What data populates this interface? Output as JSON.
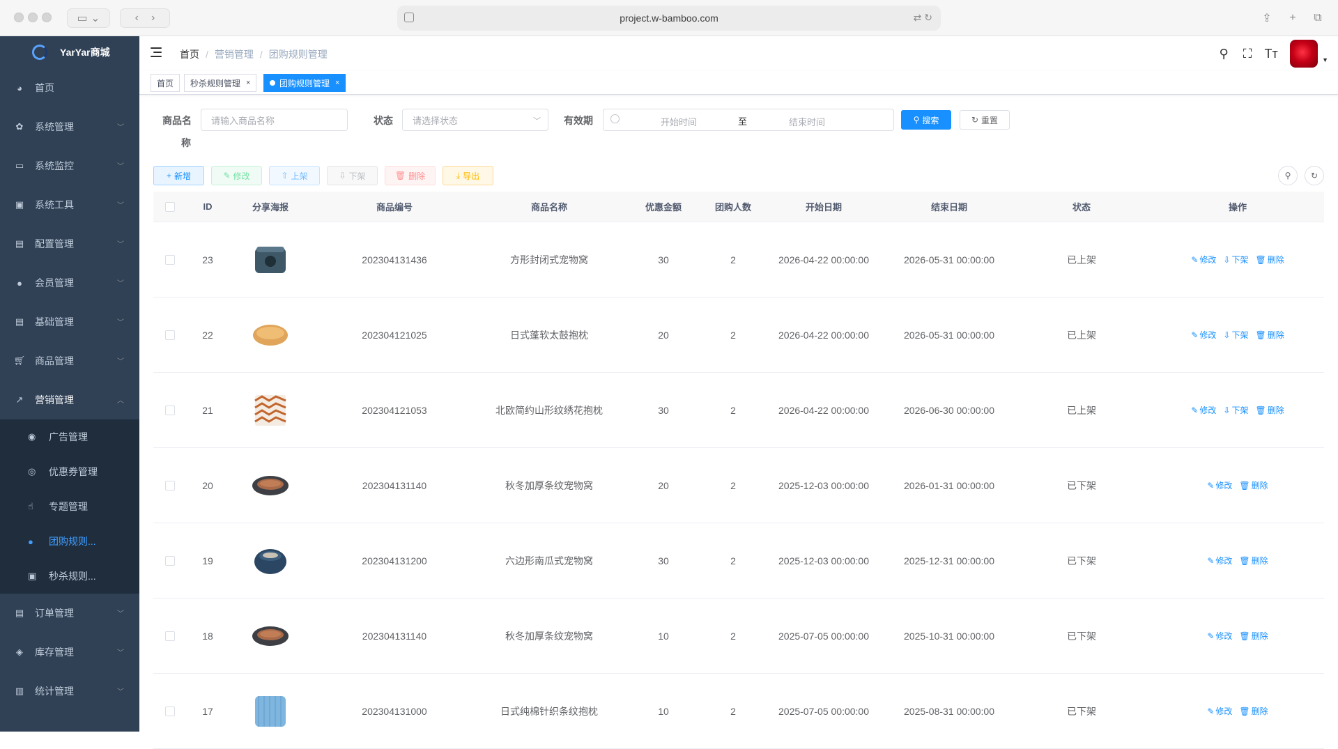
{
  "browser": {
    "url": "project.w-bamboo.com"
  },
  "app": {
    "logo_text": "YarYar商城"
  },
  "sidebar": {
    "items": [
      {
        "label": "首页",
        "icon": "dashboard-icon"
      },
      {
        "label": "系统管理",
        "icon": "gear-icon"
      },
      {
        "label": "系统监控",
        "icon": "monitor-icon"
      },
      {
        "label": "系统工具",
        "icon": "toolbox-icon"
      },
      {
        "label": "配置管理",
        "icon": "config-icon"
      },
      {
        "label": "会员管理",
        "icon": "user-icon"
      },
      {
        "label": "基础管理",
        "icon": "base-icon"
      },
      {
        "label": "商品管理",
        "icon": "cart-icon"
      },
      {
        "label": "营销管理",
        "icon": "marketing-icon"
      }
    ],
    "marketing_sub": [
      {
        "label": "广告管理",
        "icon": "eye-icon"
      },
      {
        "label": "优惠券管理",
        "icon": "coupon-icon"
      },
      {
        "label": "专题管理",
        "icon": "topic-icon"
      },
      {
        "label": "团购规则...",
        "icon": "group-icon"
      },
      {
        "label": "秒杀规则...",
        "icon": "flash-icon"
      }
    ],
    "bottom_items": [
      {
        "label": "订单管理",
        "icon": "order-icon"
      },
      {
        "label": "库存管理",
        "icon": "stock-icon"
      },
      {
        "label": "统计管理",
        "icon": "stats-icon"
      }
    ]
  },
  "breadcrumb": [
    "首页",
    "营销管理",
    "团购规则管理"
  ],
  "tags": [
    {
      "label": "首页"
    },
    {
      "label": "秒杀规则管理"
    },
    {
      "label": "团购规则管理"
    }
  ],
  "filter": {
    "name_label_1": "商品名",
    "name_label_2": "称",
    "name_placeholder": "请输入商品名称",
    "status_label": "状态",
    "status_placeholder": "请选择状态",
    "period_label": "有效期",
    "start_placeholder": "开始时间",
    "range_sep": "至",
    "end_placeholder": "结束时间",
    "search_btn": "搜索",
    "reset_btn": "重置"
  },
  "toolbar": {
    "add": "新增",
    "edit": "修改",
    "on_shelf": "上架",
    "off_shelf": "下架",
    "delete": "删除",
    "export": "导出"
  },
  "table": {
    "headers": [
      "ID",
      "分享海报",
      "商品编号",
      "商品名称",
      "优惠金额",
      "团购人数",
      "开始日期",
      "结束日期",
      "状态",
      "操作"
    ],
    "op_labels": {
      "edit": "修改",
      "off": "下架",
      "delete": "删除"
    },
    "rows": [
      {
        "id": "23",
        "code": "202304131436",
        "name": "方形封闭式宠物窝",
        "discount": "30",
        "people": "2",
        "start": "2026-04-22 00:00:00",
        "end": "2026-05-31 00:00:00",
        "status": "已上架",
        "thumb": "pet-house"
      },
      {
        "id": "22",
        "code": "202304121025",
        "name": "日式蓬软太鼓抱枕",
        "discount": "20",
        "people": "2",
        "start": "2026-04-22 00:00:00",
        "end": "2026-05-31 00:00:00",
        "status": "已上架",
        "thumb": "round-cushion"
      },
      {
        "id": "21",
        "code": "202304121053",
        "name": "北欧简约山形纹绣花抱枕",
        "discount": "30",
        "people": "2",
        "start": "2026-04-22 00:00:00",
        "end": "2026-06-30 00:00:00",
        "status": "已上架",
        "thumb": "chevron-pillow"
      },
      {
        "id": "20",
        "code": "202304131140",
        "name": "秋冬加厚条纹宠物窝",
        "discount": "20",
        "people": "2",
        "start": "2025-12-03 00:00:00",
        "end": "2026-01-31 00:00:00",
        "status": "已下架",
        "thumb": "striped-bed"
      },
      {
        "id": "19",
        "code": "202304131200",
        "name": "六边形南瓜式宠物窝",
        "discount": "30",
        "people": "2",
        "start": "2025-12-03 00:00:00",
        "end": "2025-12-31 00:00:00",
        "status": "已下架",
        "thumb": "hex-bed"
      },
      {
        "id": "18",
        "code": "202304131140",
        "name": "秋冬加厚条纹宠物窝",
        "discount": "10",
        "people": "2",
        "start": "2025-07-05 00:00:00",
        "end": "2025-10-31 00:00:00",
        "status": "已下架",
        "thumb": "striped-bed"
      },
      {
        "id": "17",
        "code": "202304131000",
        "name": "日式纯棉针织条纹抱枕",
        "discount": "10",
        "people": "2",
        "start": "2025-07-05 00:00:00",
        "end": "2025-08-31 00:00:00",
        "status": "已下架",
        "thumb": "blue-pillow"
      }
    ]
  }
}
